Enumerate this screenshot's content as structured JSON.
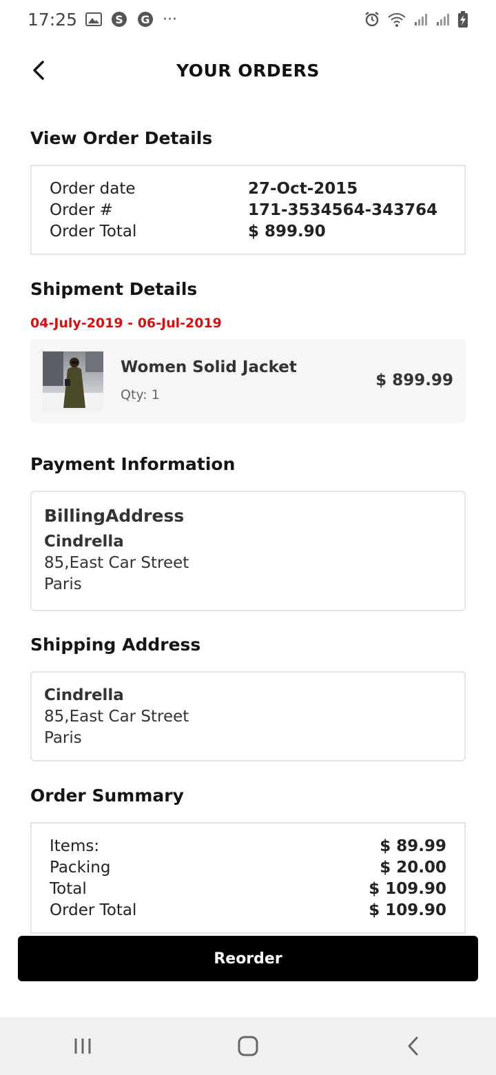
{
  "status_bar": {
    "time": "17:25",
    "left_icons": [
      "gallery-icon",
      "skype-icon",
      "google-icon",
      "more-dots-icon"
    ],
    "right_icons": [
      "alarm-icon",
      "wifi-icon",
      "signal-icon",
      "signal-icon",
      "battery-charging-icon"
    ],
    "more": "···"
  },
  "header": {
    "title": "YOUR ORDERS",
    "back_icon": "chevron-left-icon"
  },
  "order_details": {
    "title": "View Order Details",
    "rows": [
      {
        "label": "Order date",
        "value": "27-Oct-2015"
      },
      {
        "label": "Order #",
        "value": "171-3534564-343764"
      },
      {
        "label": "Order Total",
        "value": "$ 899.90"
      }
    ]
  },
  "shipment": {
    "title": "Shipment Details",
    "dates": "04-July-2019 - 06-Jul-2019",
    "item": {
      "name": "Women Solid Jacket",
      "qty": "Qty: 1",
      "price": "$ 899.99"
    }
  },
  "payment": {
    "title": "Payment Information",
    "billing_heading": "BillingAddress",
    "name": "Cindrella",
    "street": "85,East Car Street",
    "city": "Paris"
  },
  "shipping": {
    "title": "Shipping Address",
    "name": "Cindrella",
    "street": "85,East Car Street",
    "city": "Paris"
  },
  "summary": {
    "title": "Order Summary",
    "rows": [
      {
        "label": "Items:",
        "value": "$ 89.99"
      },
      {
        "label": "Packing",
        "value": "$ 20.00"
      },
      {
        "label": "Total",
        "value": "$ 109.90"
      },
      {
        "label": "Order Total",
        "value": "$ 109.90"
      }
    ]
  },
  "reorder_label": "Reorder",
  "colors": {
    "accent_red": "#d90f0f",
    "button_black": "#000000",
    "card_bg": "#f6f6f6"
  },
  "nav": {
    "icons": [
      "recent-apps-icon",
      "home-icon",
      "back-icon"
    ]
  }
}
